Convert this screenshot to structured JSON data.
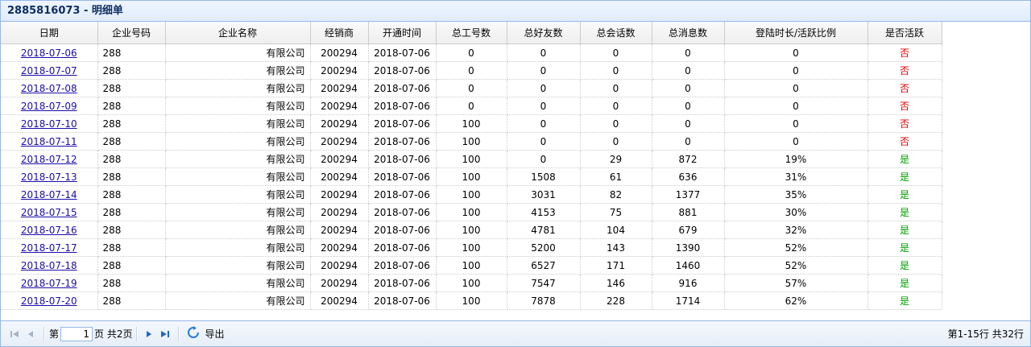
{
  "title": "2885816073 - 明细单",
  "columns": [
    "日期",
    "企业号码",
    "企业名称",
    "经销商",
    "开通时间",
    "总工号数",
    "总好友数",
    "总会话数",
    "总消息数",
    "登陆时长/活跃比例",
    "是否活跃"
  ],
  "rows": [
    {
      "date": "2018-07-06",
      "corp_no": "288",
      "corp_name": "有限公司",
      "dealer": "200294",
      "open_time": "2018-07-06",
      "staff": "0",
      "friends": "0",
      "sessions": "0",
      "messages": "0",
      "ratio": "0",
      "active": "否"
    },
    {
      "date": "2018-07-07",
      "corp_no": "288",
      "corp_name": "有限公司",
      "dealer": "200294",
      "open_time": "2018-07-06",
      "staff": "0",
      "friends": "0",
      "sessions": "0",
      "messages": "0",
      "ratio": "0",
      "active": "否"
    },
    {
      "date": "2018-07-08",
      "corp_no": "288",
      "corp_name": "有限公司",
      "dealer": "200294",
      "open_time": "2018-07-06",
      "staff": "0",
      "friends": "0",
      "sessions": "0",
      "messages": "0",
      "ratio": "0",
      "active": "否"
    },
    {
      "date": "2018-07-09",
      "corp_no": "288",
      "corp_name": "有限公司",
      "dealer": "200294",
      "open_time": "2018-07-06",
      "staff": "0",
      "friends": "0",
      "sessions": "0",
      "messages": "0",
      "ratio": "0",
      "active": "否"
    },
    {
      "date": "2018-07-10",
      "corp_no": "288",
      "corp_name": "有限公司",
      "dealer": "200294",
      "open_time": "2018-07-06",
      "staff": "100",
      "friends": "0",
      "sessions": "0",
      "messages": "0",
      "ratio": "0",
      "active": "否"
    },
    {
      "date": "2018-07-11",
      "corp_no": "288",
      "corp_name": "有限公司",
      "dealer": "200294",
      "open_time": "2018-07-06",
      "staff": "100",
      "friends": "0",
      "sessions": "0",
      "messages": "0",
      "ratio": "0",
      "active": "否"
    },
    {
      "date": "2018-07-12",
      "corp_no": "288",
      "corp_name": "有限公司",
      "dealer": "200294",
      "open_time": "2018-07-06",
      "staff": "100",
      "friends": "0",
      "sessions": "29",
      "messages": "872",
      "ratio": "19%",
      "active": "是"
    },
    {
      "date": "2018-07-13",
      "corp_no": "288",
      "corp_name": "有限公司",
      "dealer": "200294",
      "open_time": "2018-07-06",
      "staff": "100",
      "friends": "1508",
      "sessions": "61",
      "messages": "636",
      "ratio": "31%",
      "active": "是"
    },
    {
      "date": "2018-07-14",
      "corp_no": "288",
      "corp_name": "有限公司",
      "dealer": "200294",
      "open_time": "2018-07-06",
      "staff": "100",
      "friends": "3031",
      "sessions": "82",
      "messages": "1377",
      "ratio": "35%",
      "active": "是"
    },
    {
      "date": "2018-07-15",
      "corp_no": "288",
      "corp_name": "有限公司",
      "dealer": "200294",
      "open_time": "2018-07-06",
      "staff": "100",
      "friends": "4153",
      "sessions": "75",
      "messages": "881",
      "ratio": "30%",
      "active": "是"
    },
    {
      "date": "2018-07-16",
      "corp_no": "288",
      "corp_name": "有限公司",
      "dealer": "200294",
      "open_time": "2018-07-06",
      "staff": "100",
      "friends": "4781",
      "sessions": "104",
      "messages": "679",
      "ratio": "32%",
      "active": "是"
    },
    {
      "date": "2018-07-17",
      "corp_no": "288",
      "corp_name": "有限公司",
      "dealer": "200294",
      "open_time": "2018-07-06",
      "staff": "100",
      "friends": "5200",
      "sessions": "143",
      "messages": "1390",
      "ratio": "52%",
      "active": "是"
    },
    {
      "date": "2018-07-18",
      "corp_no": "288",
      "corp_name": "有限公司",
      "dealer": "200294",
      "open_time": "2018-07-06",
      "staff": "100",
      "friends": "6527",
      "sessions": "171",
      "messages": "1460",
      "ratio": "52%",
      "active": "是"
    },
    {
      "date": "2018-07-19",
      "corp_no": "288",
      "corp_name": "有限公司",
      "dealer": "200294",
      "open_time": "2018-07-06",
      "staff": "100",
      "friends": "7547",
      "sessions": "146",
      "messages": "916",
      "ratio": "57%",
      "active": "是"
    },
    {
      "date": "2018-07-20",
      "corp_no": "288",
      "corp_name": "有限公司",
      "dealer": "200294",
      "open_time": "2018-07-06",
      "staff": "100",
      "friends": "7878",
      "sessions": "228",
      "messages": "1714",
      "ratio": "62%",
      "active": "是"
    }
  ],
  "pager": {
    "page_prefix": "第",
    "page_value": "1",
    "page_suffix": "页 共2页",
    "export_label": "导出",
    "summary": "第1-15行 共32行"
  },
  "icons": {
    "first": "first-page-icon",
    "prev": "prev-page-icon",
    "next": "next-page-icon",
    "last": "last-page-icon",
    "refresh": "refresh-icon"
  },
  "colors": {
    "header_border": "#95b8e7",
    "inactive": "#e00000",
    "active": "#00a000",
    "link": "#1a0dab"
  }
}
